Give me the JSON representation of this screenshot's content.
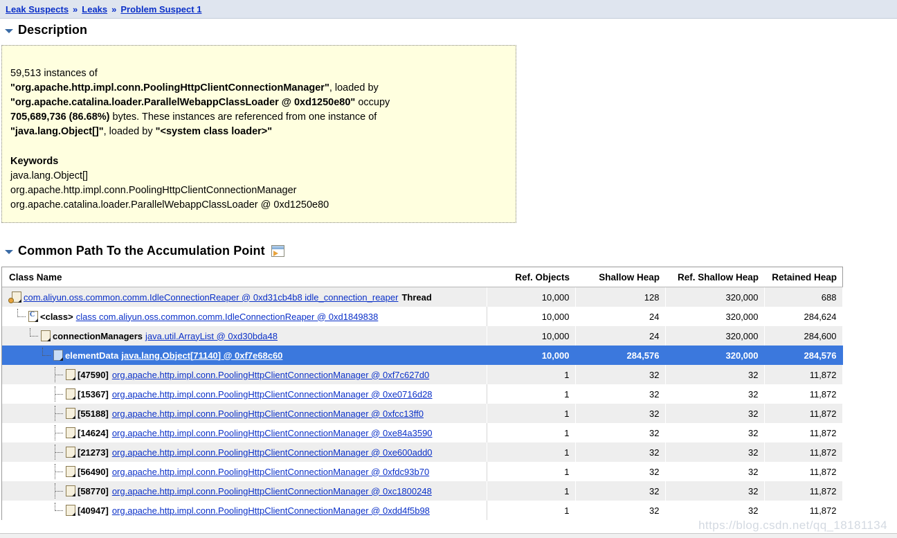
{
  "breadcrumb": {
    "items": [
      {
        "label": "Leak Suspects"
      },
      {
        "label": "Leaks"
      },
      {
        "label": "Problem Suspect 1"
      }
    ],
    "separator": "»"
  },
  "description_section": {
    "title": "Description",
    "disclosure_icon": "triangle-down-icon",
    "body": {
      "line1": "59,513 instances of",
      "line2_class": "\"org.apache.http.impl.conn.PoolingHttpClientConnectionManager\"",
      "line2_tail": ", loaded by",
      "line3_loader": "\"org.apache.catalina.loader.ParallelWebappClassLoader @ 0xd1250e80\"",
      "line3_tail": " occupy",
      "line4_bytes": "705,689,736 (86.68%)",
      "line4_tail": " bytes. These instances are referenced from one instance of",
      "line5_class": "\"java.lang.Object[]\"",
      "line5_mid": ", loaded by ",
      "line5_loader": "\"<system class loader>\""
    },
    "keywords": {
      "heading": "Keywords",
      "items": [
        "java.lang.Object[]",
        "org.apache.http.impl.conn.PoolingHttpClientConnectionManager",
        "org.apache.catalina.loader.ParallelWebappClassLoader @ 0xd1250e80"
      ]
    }
  },
  "path_section": {
    "title": "Common Path To the Accumulation Point",
    "disclosure_icon": "triangle-down-icon",
    "export_icon": "export-window-icon"
  },
  "table": {
    "columns": [
      "Class Name",
      "Ref. Objects",
      "Shallow Heap",
      "Ref. Shallow Heap",
      "Retained Heap"
    ],
    "rows": [
      {
        "icon": "object-thread-icon",
        "depth": 0,
        "link": "com.aliyun.oss.common.comm.IdleConnectionReaper @ 0xd31cb4b8 idle_connection_reaper",
        "suffix": "Thread",
        "label": "",
        "ref_objects": "10,000",
        "shallow_heap": "128",
        "ref_shallow_heap": "320,000",
        "retained_heap": "688",
        "selected": false,
        "zebra": "alt"
      },
      {
        "icon": "class-icon",
        "depth": 1,
        "label": "<class>",
        "link": "class com.aliyun.oss.common.comm.IdleConnectionReaper @ 0xd1849838",
        "suffix": "",
        "ref_objects": "10,000",
        "shallow_heap": "24",
        "ref_shallow_heap": "320,000",
        "retained_heap": "284,624",
        "selected": false,
        "zebra": "plain"
      },
      {
        "icon": "object-icon",
        "depth": 2,
        "label": "connectionManagers",
        "link": "java.util.ArrayList @ 0xd30bda48",
        "suffix": "",
        "ref_objects": "10,000",
        "shallow_heap": "24",
        "ref_shallow_heap": "320,000",
        "retained_heap": "284,600",
        "selected": false,
        "zebra": "alt"
      },
      {
        "icon": "array-icon",
        "depth": 3,
        "label": "elementData",
        "link": "java.lang.Object[71140] @ 0xf7e68c60",
        "suffix": "",
        "ref_objects": "10,000",
        "shallow_heap": "284,576",
        "ref_shallow_heap": "320,000",
        "retained_heap": "284,576",
        "selected": true,
        "zebra": "sel"
      },
      {
        "icon": "object-icon",
        "depth": 4,
        "label": "[47590]",
        "link": "org.apache.http.impl.conn.PoolingHttpClientConnectionManager @ 0xf7c627d0",
        "suffix": "",
        "ref_objects": "1",
        "shallow_heap": "32",
        "ref_shallow_heap": "32",
        "retained_heap": "11,872",
        "selected": false,
        "zebra": "alt"
      },
      {
        "icon": "object-icon",
        "depth": 4,
        "label": "[15367]",
        "link": "org.apache.http.impl.conn.PoolingHttpClientConnectionManager @ 0xe0716d28",
        "suffix": "",
        "ref_objects": "1",
        "shallow_heap": "32",
        "ref_shallow_heap": "32",
        "retained_heap": "11,872",
        "selected": false,
        "zebra": "plain"
      },
      {
        "icon": "object-icon",
        "depth": 4,
        "label": "[55188]",
        "link": "org.apache.http.impl.conn.PoolingHttpClientConnectionManager @ 0xfcc13ff0",
        "suffix": "",
        "ref_objects": "1",
        "shallow_heap": "32",
        "ref_shallow_heap": "32",
        "retained_heap": "11,872",
        "selected": false,
        "zebra": "alt"
      },
      {
        "icon": "object-icon",
        "depth": 4,
        "label": "[14624]",
        "link": "org.apache.http.impl.conn.PoolingHttpClientConnectionManager @ 0xe84a3590",
        "suffix": "",
        "ref_objects": "1",
        "shallow_heap": "32",
        "ref_shallow_heap": "32",
        "retained_heap": "11,872",
        "selected": false,
        "zebra": "plain"
      },
      {
        "icon": "object-icon",
        "depth": 4,
        "label": "[21273]",
        "link": "org.apache.http.impl.conn.PoolingHttpClientConnectionManager @ 0xe600add0",
        "suffix": "",
        "ref_objects": "1",
        "shallow_heap": "32",
        "ref_shallow_heap": "32",
        "retained_heap": "11,872",
        "selected": false,
        "zebra": "alt"
      },
      {
        "icon": "object-icon",
        "depth": 4,
        "label": "[56490]",
        "link": "org.apache.http.impl.conn.PoolingHttpClientConnectionManager @ 0xfdc93b70",
        "suffix": "",
        "ref_objects": "1",
        "shallow_heap": "32",
        "ref_shallow_heap": "32",
        "retained_heap": "11,872",
        "selected": false,
        "zebra": "plain"
      },
      {
        "icon": "object-icon",
        "depth": 4,
        "label": "[58770]",
        "link": "org.apache.http.impl.conn.PoolingHttpClientConnectionManager @ 0xc1800248",
        "suffix": "",
        "ref_objects": "1",
        "shallow_heap": "32",
        "ref_shallow_heap": "32",
        "retained_heap": "11,872",
        "selected": false,
        "zebra": "alt"
      },
      {
        "icon": "object-icon",
        "depth": 4,
        "label": "[40947]",
        "link": "org.apache.http.impl.conn.PoolingHttpClientConnectionManager @ 0xdd4f5b98",
        "suffix": "",
        "ref_objects": "1",
        "shallow_heap": "32",
        "ref_shallow_heap": "32",
        "retained_heap": "11,872",
        "selected": false,
        "zebra": "plain"
      }
    ]
  },
  "watermark": {
    "text": "https://blog.csdn.net/qq_18181134"
  },
  "colors": {
    "link": "#0a30c8",
    "selection": "#3b78dd",
    "breadcrumb_bg": "#dfe5ef",
    "description_bg": "#ffffdf",
    "zebra_row": "#eeeeee"
  }
}
